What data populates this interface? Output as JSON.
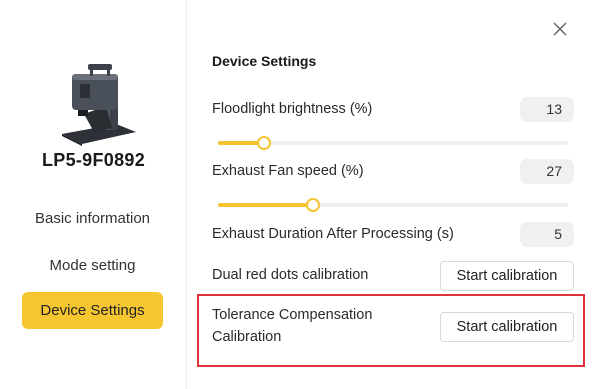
{
  "sidebar": {
    "device_name": "LP5-9F0892",
    "items": [
      {
        "label": "Basic information",
        "active": false
      },
      {
        "label": "Mode setting",
        "active": false
      },
      {
        "label": "Device Settings",
        "active": true
      }
    ]
  },
  "main": {
    "title": "Device Settings",
    "floodlight": {
      "label": "Floodlight brightness (%)",
      "value": "13",
      "level": 0.13
    },
    "exhaust_fan": {
      "label": "Exhaust Fan speed (%)",
      "value": "27",
      "level": 0.27
    },
    "exhaust_duration": {
      "label": "Exhaust Duration After Processing (s)",
      "value": "5"
    },
    "dual_red": {
      "label": "Dual red dots calibration",
      "button": "Start calibration"
    },
    "tolerance": {
      "label_line1": "Tolerance Compensation",
      "label_line2": "Calibration",
      "button": "Start calibration"
    }
  },
  "colors": {
    "accent": "#f6c630",
    "highlight": "#e0323a"
  },
  "icons": {
    "close": "close-icon",
    "device": "laser-engraver-icon"
  }
}
